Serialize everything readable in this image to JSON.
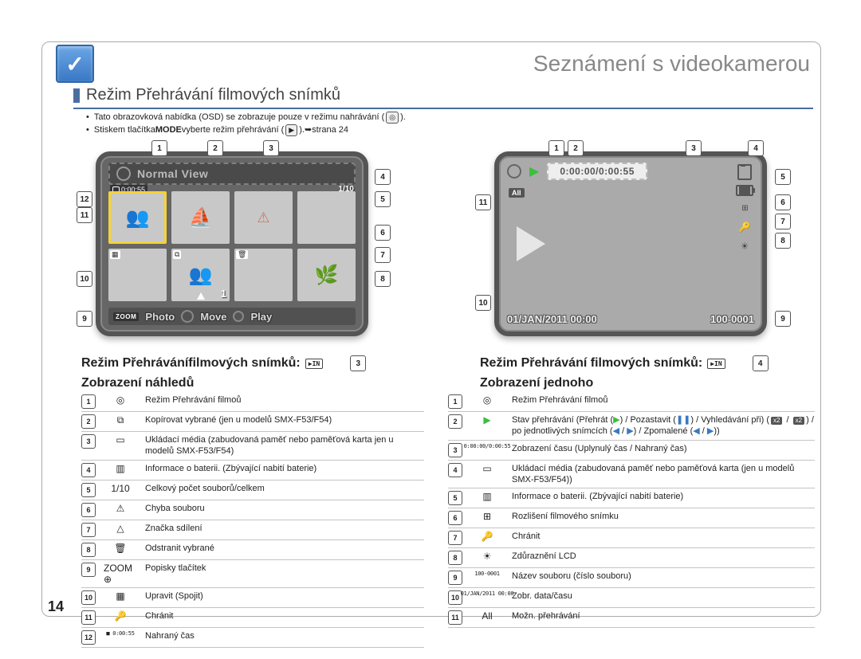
{
  "page_number": "14",
  "chapter_title": "Seznámení s videokamerou",
  "section_title": "Režim Přehrávání filmových snímků",
  "intro": {
    "line1a": "Tato obrazovková nabídka (OSD) se zobrazuje pouze v režimu nahrávání (",
    "line1b": ").",
    "line2a": "Stiskem tlačítka ",
    "line2_mode": "MODE",
    "line2b": " vyberte režim přehrávání (",
    "line2c": "). ",
    "line2_page": "strana 24"
  },
  "thumb_check": "✓",
  "lcd_left": {
    "header": "Normal View",
    "rec_time": "0:00:55",
    "counter": "1/10",
    "thumb_overlay": "1",
    "footer_zoom": "ZOOM",
    "footer_photo": "Photo",
    "footer_move": "Move",
    "footer_play": "Play"
  },
  "lcd_right": {
    "time": "0:00:00/0:00:55",
    "all_label": "All",
    "date": "01/JAN/2011 00:00",
    "file": "100-0001"
  },
  "sub_left": {
    "line1": "Režim Přehráváníﬁlmových snímků:",
    "store": "IN",
    "callout": "3",
    "line2": "Zobrazení náhledů"
  },
  "sub_right": {
    "line1": "Režim Přehrávání ﬁlmových snímků:",
    "store": "IN",
    "callout": "4",
    "line2": "Zobrazení jednoho"
  },
  "legend_left": [
    {
      "n": "1",
      "icon": "◎",
      "text": "Režim Přehrávání filmoů"
    },
    {
      "n": "2",
      "icon": "⧉",
      "text": "Kopírovat vybrané (jen u modelů SMX-F53/F54)"
    },
    {
      "n": "3",
      "icon": "▭",
      "text": "Ukládací média (zabudovaná paměť nebo paměťová karta jen u modelů SMX-F53/F54)"
    },
    {
      "n": "4",
      "icon": "▥",
      "text": "Informace o baterii. (Zbývající nabití baterie)"
    },
    {
      "n": "5",
      "icon": "1/10",
      "text": "Celkový počet souborů/celkem"
    },
    {
      "n": "6",
      "icon": "⚠",
      "text": "Chyba souboru"
    },
    {
      "n": "7",
      "icon": "△",
      "text": "Značka sdílení"
    },
    {
      "n": "8",
      "icon": "🗑",
      "text": "Odstranit vybrané"
    },
    {
      "n": "9",
      "icon": "ZOOM ⊕",
      "text": "Popisky tlačítek"
    },
    {
      "n": "10",
      "icon": "▦",
      "text": "Upravit (Spojit)"
    },
    {
      "n": "11",
      "icon": "🔑",
      "text": "Chránit"
    },
    {
      "n": "12",
      "icon": "■ 0:00:55",
      "text": "Nahraný čas"
    }
  ],
  "legend_right": [
    {
      "n": "1",
      "icon": "◎",
      "text": "Režim Přehrávání filmoů"
    },
    {
      "n": "2",
      "icon": "▶",
      "special": "playback",
      "text_pre": "Stav přehrávání (Přehrát (",
      "text_a": ") / Pozastavit (",
      "text_b": ") / Vyhledávání při) (",
      "x2a": "x2",
      "sep1": " / ",
      "x2b": "x2",
      "text_c": ") / po jednotlivých snímcích (",
      "t1": "◀",
      "sep2": " / ",
      "t2": "▶",
      "text_d": ") / Zpomalené (",
      "t3": "◀",
      "sep3": " / ",
      "t4": "▶",
      "text_e": "))"
    },
    {
      "n": "3",
      "icon": "0:00:00/0:00:55",
      "text": "Zobrazení času (Uplynulý čas / Nahraný čas)"
    },
    {
      "n": "4",
      "icon": "▭",
      "text": "Ukládací média (zabudovaná paměť nebo paměťová karta (jen u modelů SMX-F53/F54))"
    },
    {
      "n": "5",
      "icon": "▥",
      "text": "Informace o baterii. (Zbývající nabití baterie)"
    },
    {
      "n": "6",
      "icon": "⊞",
      "text": "Rozlišení filmového snímku"
    },
    {
      "n": "7",
      "icon": "🔑",
      "text": "Chránit"
    },
    {
      "n": "8",
      "icon": "☀",
      "text": "Zdůraznění LCD"
    },
    {
      "n": "9",
      "icon": "100-0001",
      "text": "Název souboru (číslo souboru)"
    },
    {
      "n": "10",
      "icon": "01/JAN/2011 00:00",
      "text": "Zobr. data/času"
    },
    {
      "n": "11",
      "icon": "All",
      "text": "Možn. přehrávání"
    }
  ]
}
